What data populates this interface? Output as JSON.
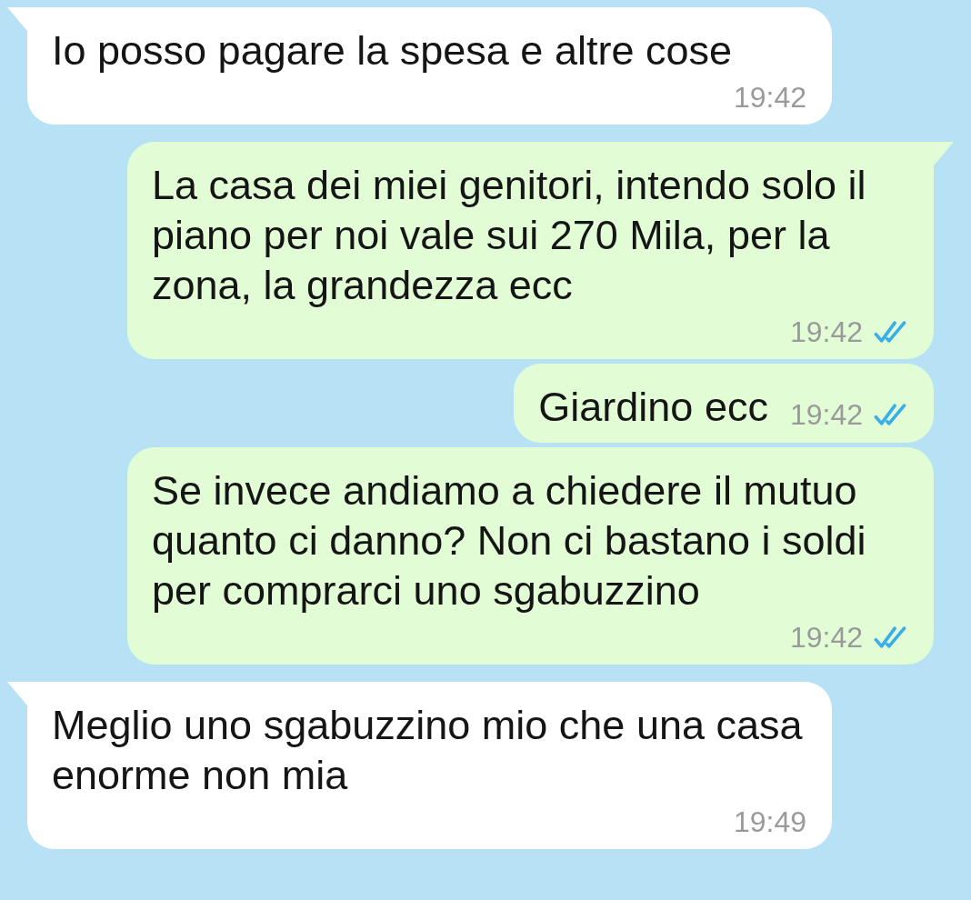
{
  "messages": [
    {
      "kind": "incoming",
      "tail": true,
      "text": "Io posso pagare la spesa e altre cose",
      "time": "19:42"
    },
    {
      "kind": "outgoing",
      "tail": true,
      "text": "La casa dei miei genitori, intendo solo il piano per noi vale sui 270 Mila, per la zona, la grandezza ecc",
      "time": "19:42",
      "read": true
    },
    {
      "kind": "outgoing",
      "tail": false,
      "text": "Giardino ecc",
      "time": "19:42",
      "read": true
    },
    {
      "kind": "outgoing",
      "tail": false,
      "text": "Se invece andiamo a chiedere il mutuo quanto ci danno? Non ci bastano i soldi per comprarci uno sgabuzzino",
      "time": "19:42",
      "read": true
    },
    {
      "kind": "incoming",
      "tail": true,
      "text": "Meglio uno sgabuzzino mio che una casa enorme non mia",
      "time": "19:49"
    }
  ]
}
